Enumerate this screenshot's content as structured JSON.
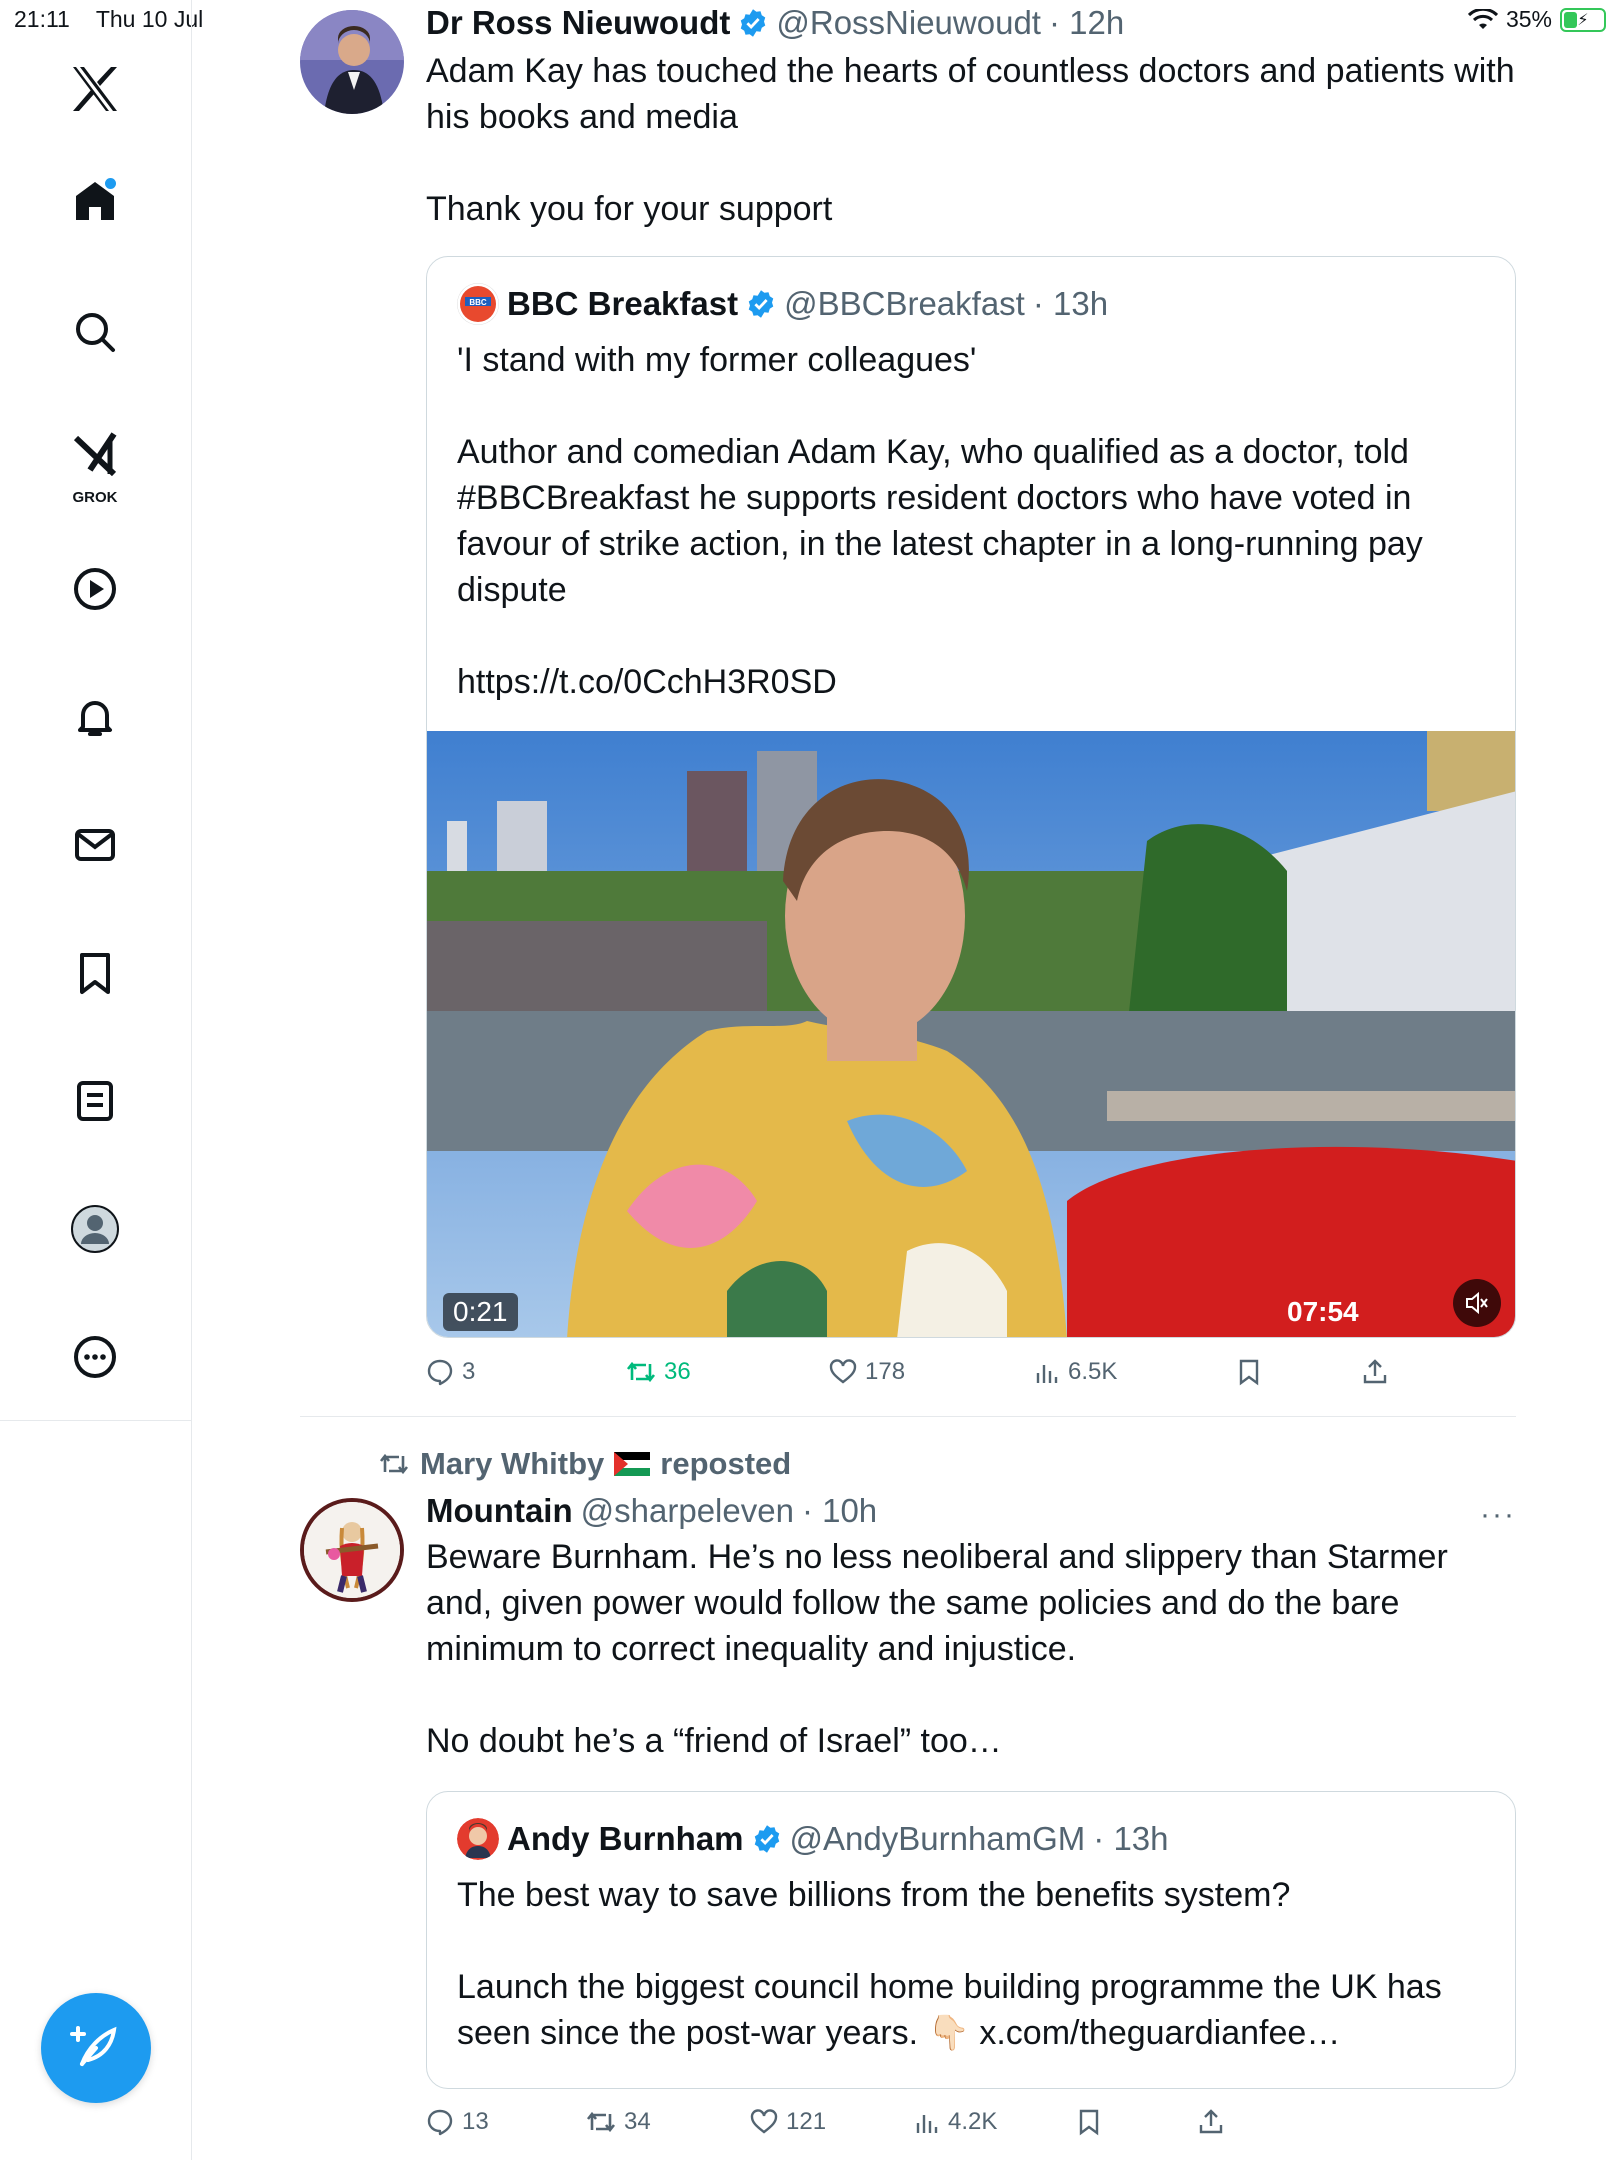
{
  "status_bar": {
    "time": "21:11",
    "date": "Thu 10 Jul",
    "battery": "35%",
    "battery_level": 0.35
  },
  "sidebar": {
    "grok_label": "GROK",
    "items": [
      "home",
      "search",
      "grok",
      "videos",
      "notifications",
      "messages",
      "bookmarks",
      "lists",
      "profile",
      "more"
    ]
  },
  "colors": {
    "accent": "#1d9bf0",
    "text": "#0f1419",
    "secondary": "#536471",
    "retweet": "#00ba7c",
    "border": "#cfd9de"
  },
  "post1": {
    "author": "Dr Ross Nieuwoudt",
    "handle": "@RossNieuwoudt",
    "time": "· 12h",
    "text": "Adam Kay has touched the hearts of countless doctors and patients with his books and media\n\nThank you for your support",
    "quote": {
      "author": "BBC Breakfast",
      "handle": "@BBCBreakfast",
      "time": "· 13h",
      "text": "'I stand with my former colleagues'\n\nAuthor and comedian Adam Kay, who qualified as a doctor, told #BBCBreakfast he supports resident doctors who have voted in favour of strike action, in the latest chapter in a long-running pay dispute\n\nhttps://t.co/0CchH3R0SD",
      "video_elapsed": "0:21",
      "video_duration": "07:54"
    },
    "stats": {
      "replies": "3",
      "reposts": "36",
      "likes": "178",
      "views": "6.5K"
    }
  },
  "post2": {
    "reposted_by": "Mary Whitby",
    "reposted_label": "reposted",
    "author": "Mountain",
    "handle": "@sharpeleven",
    "time": "· 10h",
    "more": "···",
    "text": "Beware Burnham. He’s no less neoliberal and slippery than Starmer and, given power would follow the same policies and do the bare minimum to correct inequality and injustice.\n\nNo doubt he’s a “friend of Israel” too…",
    "quote": {
      "author": "Andy Burnham",
      "handle": "@AndyBurnhamGM",
      "time": "· 13h",
      "text": "The best way to save billions from the benefits system?\n\nLaunch the biggest council home building programme the UK has seen since the post-war years. 👇🏻 x.com/theguardianfee…"
    },
    "stats": {
      "replies": "13",
      "reposts": "34",
      "likes": "121",
      "views": "4.2K"
    }
  }
}
